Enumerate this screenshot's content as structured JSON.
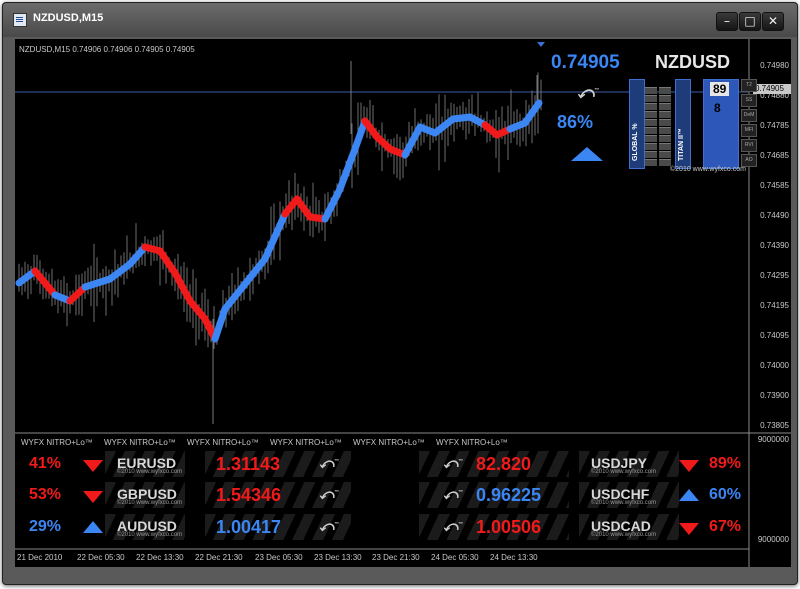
{
  "window": {
    "title": "NZDUSD,M15"
  },
  "chart_header": {
    "symbol_info": "NZDUSD,M15  0.74906 0.74906 0.74905 0.74905"
  },
  "colors": {
    "up": "#3b86f3",
    "down": "#f11a1a",
    "background": "#000000",
    "axis_text": "#c8c8c8"
  },
  "price_axis": [
    "0.74980",
    "0.74880",
    "0.74785",
    "0.74685",
    "0.74585",
    "0.74490",
    "0.74390",
    "0.74295",
    "0.74195",
    "0.74095",
    "0.74000",
    "0.73900",
    "0.73805"
  ],
  "current_price_label": "0.74905",
  "sub_axis": {
    "top": "9000000",
    "bottom": "9000000"
  },
  "time_axis": [
    "21 Dec 2010",
    "22 Dec 05:30",
    "22 Dec 13:30",
    "22 Dec 21:30",
    "23 Dec 05:30",
    "23 Dec 13:30",
    "23 Dec 21:30",
    "24 Dec 05:30",
    "24 Dec 13:30"
  ],
  "indicator_label": "WYFX NITRO+Lo™",
  "widget": {
    "price": "0.74905",
    "symbol": "NZDUSD",
    "strength": "86%",
    "global_label": "GLOBAL %",
    "titan_label": "TITAN II™",
    "value_top": "89",
    "value_bottom": "8",
    "side_buttons": [
      "T2",
      "SS",
      "DeM",
      "MFI",
      "RVI",
      "AO"
    ],
    "copyright": "©2010 www.wyfxco.com",
    "logo_tm": "™",
    "direction": "up"
  },
  "tickers_left": [
    {
      "pct": "41%",
      "symbol": "EURUSD",
      "price": "1.31143",
      "direction": "down",
      "copy": "©2010 www.wyfxco.com"
    },
    {
      "pct": "53%",
      "symbol": "GBPUSD",
      "price": "1.54346",
      "direction": "down",
      "copy": "©2010 www.wyfxco.com"
    },
    {
      "pct": "29%",
      "symbol": "AUDUSD",
      "price": "1.00417",
      "direction": "up",
      "copy": "©2010 www.wyfxco.com"
    }
  ],
  "tickers_right": [
    {
      "price": "82.820",
      "symbol": "USDJPY",
      "pct": "89%",
      "direction": "down",
      "copy": "©2010 www.wyfxco.com"
    },
    {
      "price": "0.96225",
      "symbol": "USDCHF",
      "pct": "60%",
      "direction": "up",
      "copy": "©2010 www.wyfxco.com"
    },
    {
      "price": "1.00506",
      "symbol": "USDCAD",
      "pct": "67%",
      "direction": "down",
      "copy": "©2010 www.wyfxco.com"
    }
  ],
  "logo_tm": "™"
}
